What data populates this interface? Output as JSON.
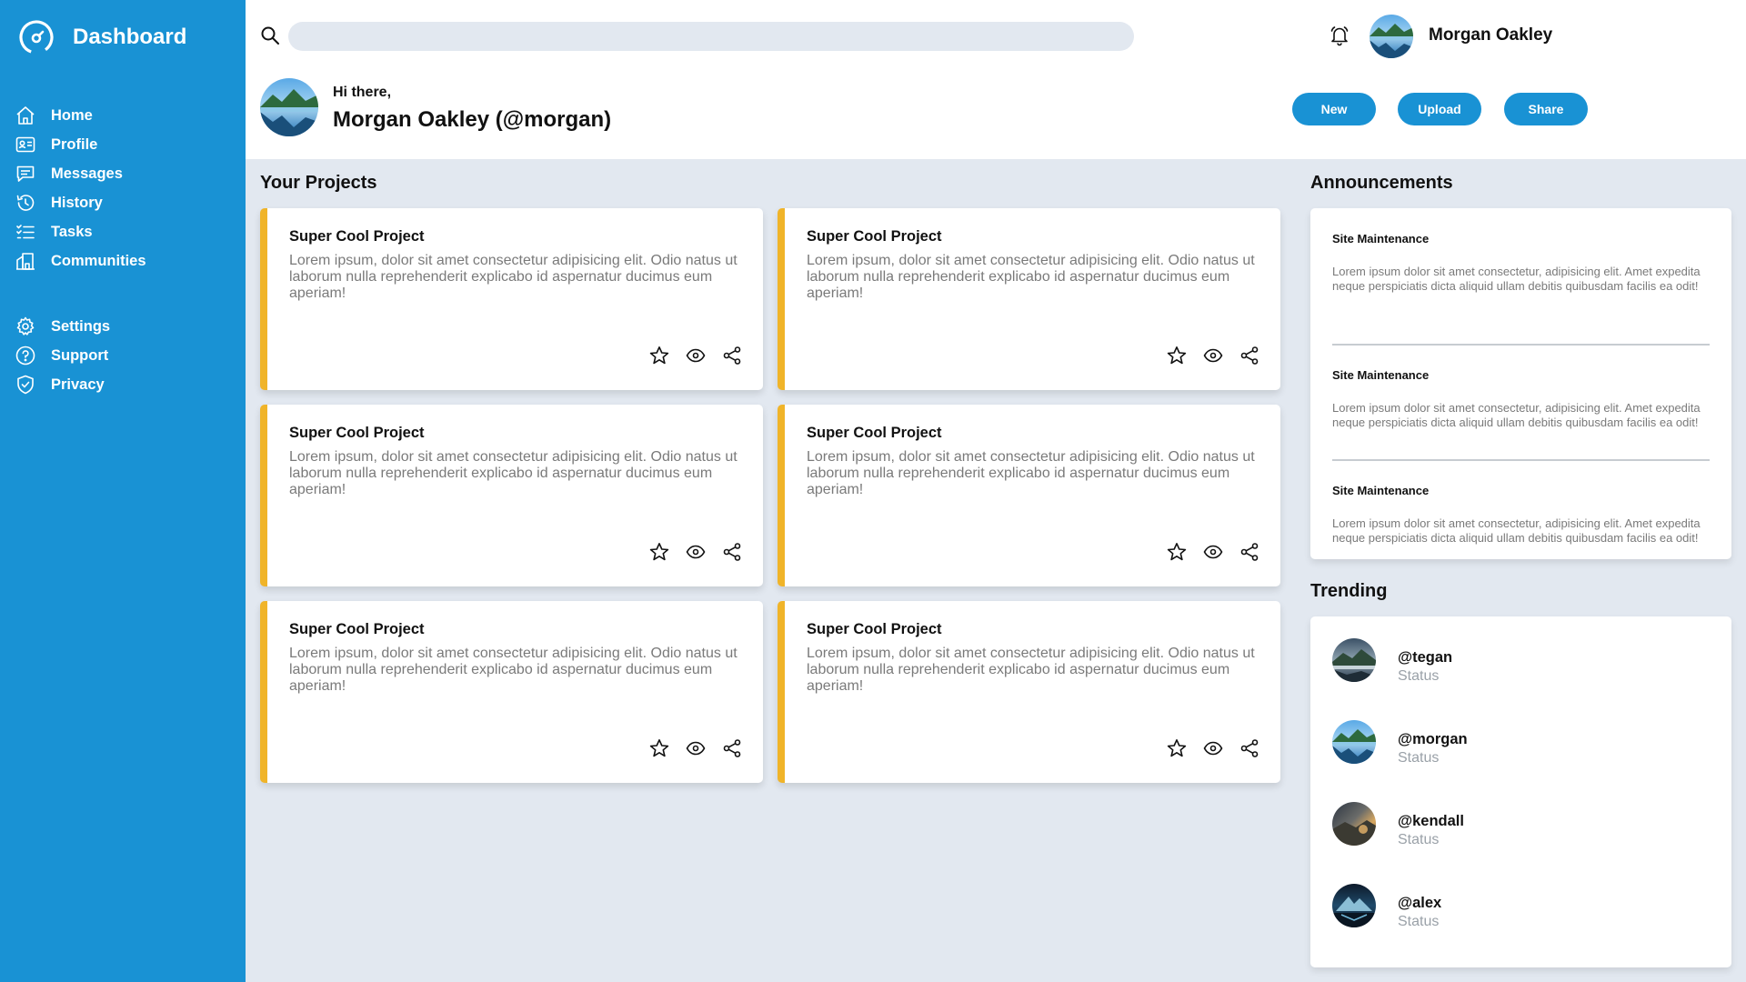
{
  "brand": {
    "title": "Dashboard",
    "icon": "dashboard-gauge-icon"
  },
  "sidebar": {
    "main_items": [
      {
        "label": "Home",
        "icon": "home-icon"
      },
      {
        "label": "Profile",
        "icon": "profile-card-icon"
      },
      {
        "label": "Messages",
        "icon": "messages-icon"
      },
      {
        "label": "History",
        "icon": "history-icon"
      },
      {
        "label": "Tasks",
        "icon": "tasks-icon"
      },
      {
        "label": "Communities",
        "icon": "communities-icon"
      }
    ],
    "secondary_items": [
      {
        "label": "Settings",
        "icon": "settings-icon"
      },
      {
        "label": "Support",
        "icon": "support-icon"
      },
      {
        "label": "Privacy",
        "icon": "privacy-shield-icon"
      }
    ]
  },
  "header": {
    "search_placeholder": "",
    "user_name": "Morgan Oakley",
    "greeting": "Hi there,",
    "greeting_name": "Morgan Oakley (@morgan)",
    "buttons": {
      "new": "New",
      "upload": "Upload",
      "share": "Share"
    }
  },
  "projects": {
    "title": "Your Projects",
    "items": [
      {
        "title": "Super Cool Project",
        "body": "Lorem ipsum, dolor sit amet consectetur adipisicing elit. Odio natus ut laborum nulla reprehenderit explicabo id aspernatur ducimus eum aperiam!"
      },
      {
        "title": "Super Cool Project",
        "body": "Lorem ipsum, dolor sit amet consectetur adipisicing elit. Odio natus ut laborum nulla reprehenderit explicabo id aspernatur ducimus eum aperiam!"
      },
      {
        "title": "Super Cool Project",
        "body": "Lorem ipsum, dolor sit amet consectetur adipisicing elit. Odio natus ut laborum nulla reprehenderit explicabo id aspernatur ducimus eum aperiam!"
      },
      {
        "title": "Super Cool Project",
        "body": "Lorem ipsum, dolor sit amet consectetur adipisicing elit. Odio natus ut laborum nulla reprehenderit explicabo id aspernatur ducimus eum aperiam!"
      },
      {
        "title": "Super Cool Project",
        "body": "Lorem ipsum, dolor sit amet consectetur adipisicing elit. Odio natus ut laborum nulla reprehenderit explicabo id aspernatur ducimus eum aperiam!"
      },
      {
        "title": "Super Cool Project",
        "body": "Lorem ipsum, dolor sit amet consectetur adipisicing elit. Odio natus ut laborum nulla reprehenderit explicabo id aspernatur ducimus eum aperiam!"
      }
    ],
    "action_icons": [
      "star-icon",
      "eye-icon",
      "share-icon"
    ]
  },
  "announcements": {
    "title": "Announcements",
    "items": [
      {
        "title": "Site Maintenance",
        "body": "Lorem ipsum dolor sit amet consectetur, adipisicing elit. Amet expedita neque perspiciatis dicta aliquid ullam debitis quibusdam facilis ea odit!"
      },
      {
        "title": "Site Maintenance",
        "body": "Lorem ipsum dolor sit amet consectetur, adipisicing elit. Amet expedita neque perspiciatis dicta aliquid ullam debitis quibusdam facilis ea odit!"
      },
      {
        "title": "Site Maintenance",
        "body": "Lorem ipsum dolor sit amet consectetur, adipisicing elit. Amet expedita neque perspiciatis dicta aliquid ullam debitis quibusdam facilis ea odit!"
      }
    ]
  },
  "trending": {
    "title": "Trending",
    "items": [
      {
        "handle": "@tegan",
        "status": "Status"
      },
      {
        "handle": "@morgan",
        "status": "Status"
      },
      {
        "handle": "@kendall",
        "status": "Status"
      },
      {
        "handle": "@alex",
        "status": "Status"
      }
    ]
  },
  "colors": {
    "sidebar": "#1992d4",
    "accent_border": "#f0b429",
    "page_background": "#e2e8f0",
    "button": "#1992d4"
  }
}
